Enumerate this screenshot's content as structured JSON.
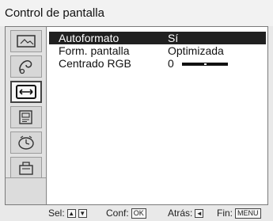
{
  "window": {
    "title": "Control de pantalla"
  },
  "sidebar": {
    "items": [
      {
        "icon": "picture-icon"
      },
      {
        "icon": "sound-icon"
      },
      {
        "icon": "screen-control-icon",
        "selected": true
      },
      {
        "icon": "channel-setup-icon"
      },
      {
        "icon": "timer-icon"
      },
      {
        "icon": "settings-icon"
      }
    ]
  },
  "menu": {
    "rows": [
      {
        "label": "Autoformato",
        "value": "Sí",
        "selected": true
      },
      {
        "label": "Form. pantalla",
        "value": "Optimizada"
      },
      {
        "label": "Centrado RGB",
        "value": "0",
        "level": 0.5
      }
    ]
  },
  "footer": {
    "select_label": "Sel:",
    "select_keys": [
      "▲",
      "▼"
    ],
    "confirm_label": "Conf:",
    "confirm_key": "OK",
    "back_label": "Atrás:",
    "back_key": "◄",
    "exit_label": "Fin:",
    "exit_key": "MENU"
  }
}
